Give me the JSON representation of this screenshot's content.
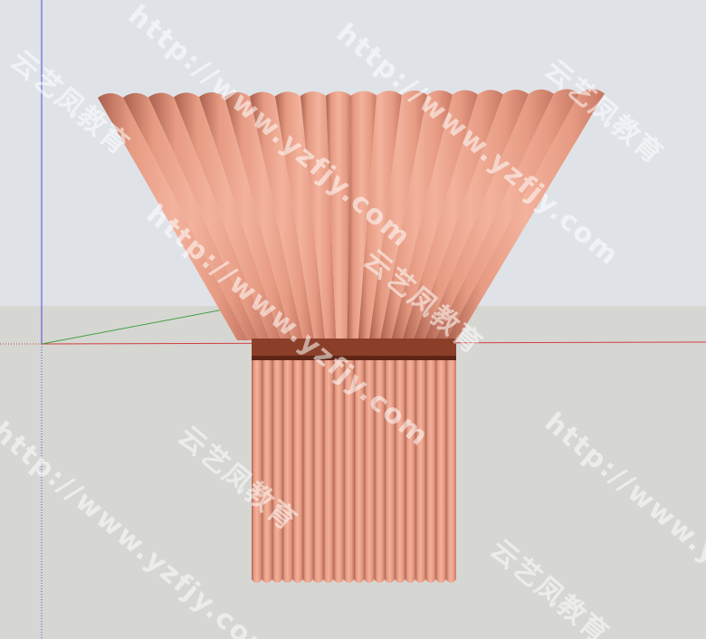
{
  "scene": {
    "sky_color": "#dfe3e8",
    "ground_color": "#d6d6d3",
    "fabric_light": "#f3b29c",
    "fabric_mid": "#e69a82",
    "fabric_dark": "#c77863",
    "fabric_shadow": "#a9604d",
    "band_color": "#8b3f28",
    "band_edge": "#5e2616",
    "axis_red": "#d04040",
    "axis_green": "#40a040",
    "axis_blue": "#4a4ae0"
  },
  "watermark": {
    "url_text": "http://www.yzfjy.com",
    "brand_text": "云艺凤教育",
    "color": "#ffffff"
  }
}
